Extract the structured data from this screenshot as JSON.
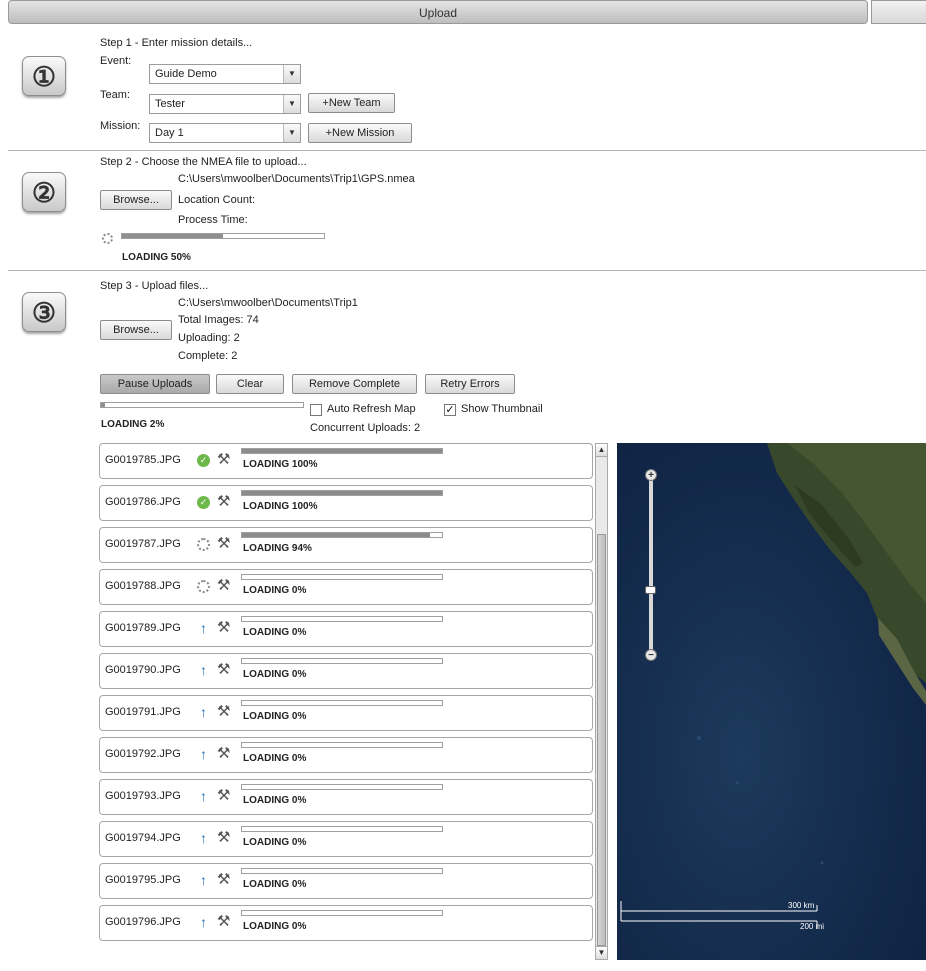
{
  "window": {
    "title": "Upload"
  },
  "step1": {
    "icon": "①",
    "heading": "Step 1 - Enter mission details...",
    "event_label": "Event:",
    "event_value": "Guide Demo",
    "team_label": "Team:",
    "team_value": "Tester",
    "new_team_label": "+New Team",
    "mission_label": "Mission:",
    "mission_value": "Day 1",
    "new_mission_label": "+New Mission"
  },
  "step2": {
    "icon": "②",
    "heading": "Step 2 - Choose the NMEA file to upload...",
    "browse_label": "Browse...",
    "file_path": "C:\\Users\\mwoolber\\Documents\\Trip1\\GPS.nmea",
    "location_count": "Location Count:",
    "process_time": "Process Time:",
    "progress": 0.5,
    "loading_text": "LOADING 50%"
  },
  "step3": {
    "icon": "③",
    "heading": "Step 3 - Upload files...",
    "browse_label": "Browse...",
    "folder_path": "C:\\Users\\mwoolber\\Documents\\Trip1",
    "total_images": "Total Images: 74",
    "uploading": "Uploading: 2",
    "complete": "Complete: 2",
    "pause_label": "Pause Uploads",
    "clear_label": "Clear",
    "remove_complete_label": "Remove Complete",
    "retry_errors_label": "Retry Errors",
    "progress": 0.02,
    "loading_text": "LOADING 2%",
    "auto_refresh_label": "Auto Refresh Map",
    "auto_refresh_checked": false,
    "show_thumbnail_label": "Show Thumbnail",
    "show_thumbnail_checked": true,
    "concurrent_uploads": "Concurrent Uploads: 2"
  },
  "uploads": [
    {
      "file": "G0019785.JPG",
      "status": "complete",
      "progress": 1.0,
      "text": "LOADING 100%"
    },
    {
      "file": "G0019786.JPG",
      "status": "complete",
      "progress": 1.0,
      "text": "LOADING 100%"
    },
    {
      "file": "G0019787.JPG",
      "status": "uploading",
      "progress": 0.94,
      "text": "LOADING 94%"
    },
    {
      "file": "G0019788.JPG",
      "status": "uploading",
      "progress": 0.0,
      "text": "LOADING 0%"
    },
    {
      "file": "G0019789.JPG",
      "status": "queued",
      "progress": 0.0,
      "text": "LOADING 0%"
    },
    {
      "file": "G0019790.JPG",
      "status": "queued",
      "progress": 0.0,
      "text": "LOADING 0%"
    },
    {
      "file": "G0019791.JPG",
      "status": "queued",
      "progress": 0.0,
      "text": "LOADING 0%"
    },
    {
      "file": "G0019792.JPG",
      "status": "queued",
      "progress": 0.0,
      "text": "LOADING 0%"
    },
    {
      "file": "G0019793.JPG",
      "status": "queued",
      "progress": 0.0,
      "text": "LOADING 0%"
    },
    {
      "file": "G0019794.JPG",
      "status": "queued",
      "progress": 0.0,
      "text": "LOADING 0%"
    },
    {
      "file": "G0019795.JPG",
      "status": "queued",
      "progress": 0.0,
      "text": "LOADING 0%"
    },
    {
      "file": "G0019796.JPG",
      "status": "queued",
      "progress": 0.0,
      "text": "LOADING 0%"
    }
  ],
  "map": {
    "zoom_in": "+",
    "zoom_out": "−",
    "zoom_level": 0.35,
    "scale_km": "300 km",
    "scale_mi": "200 mi"
  }
}
